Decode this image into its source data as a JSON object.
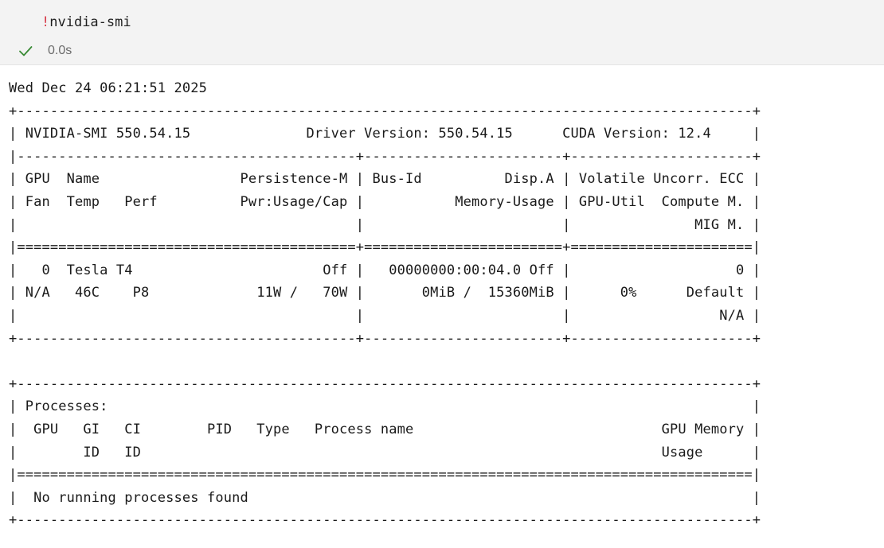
{
  "cell": {
    "code_prefix": "!",
    "code_command": "nvidia-smi",
    "exec_time": "0.0s",
    "status_icon": "check-icon",
    "status_color": "#388a34"
  },
  "output": {
    "lines": [
      "Wed Dec 24 06:21:51 2025       ",
      "+-----------------------------------------------------------------------------------------+",
      "| NVIDIA-SMI 550.54.15              Driver Version: 550.54.15      CUDA Version: 12.4     |",
      "|-----------------------------------------+------------------------+----------------------+",
      "| GPU  Name                 Persistence-M | Bus-Id          Disp.A | Volatile Uncorr. ECC |",
      "| Fan  Temp   Perf          Pwr:Usage/Cap |           Memory-Usage | GPU-Util  Compute M. |",
      "|                                         |                        |               MIG M. |",
      "|=========================================+========================+======================|",
      "|   0  Tesla T4                       Off |   00000000:00:04.0 Off |                    0 |",
      "| N/A   46C    P8             11W /   70W |       0MiB /  15360MiB |      0%      Default |",
      "|                                         |                        |                  N/A |",
      "+-----------------------------------------+------------------------+----------------------+",
      "                                                                                         ",
      "+-----------------------------------------------------------------------------------------+",
      "| Processes:                                                                              |",
      "|  GPU   GI   CI        PID   Type   Process name                              GPU Memory |",
      "|        ID   ID                                                               Usage      |",
      "|=========================================================================================|",
      "|  No running processes found                                                             |",
      "+-----------------------------------------------------------------------------------------+"
    ]
  }
}
